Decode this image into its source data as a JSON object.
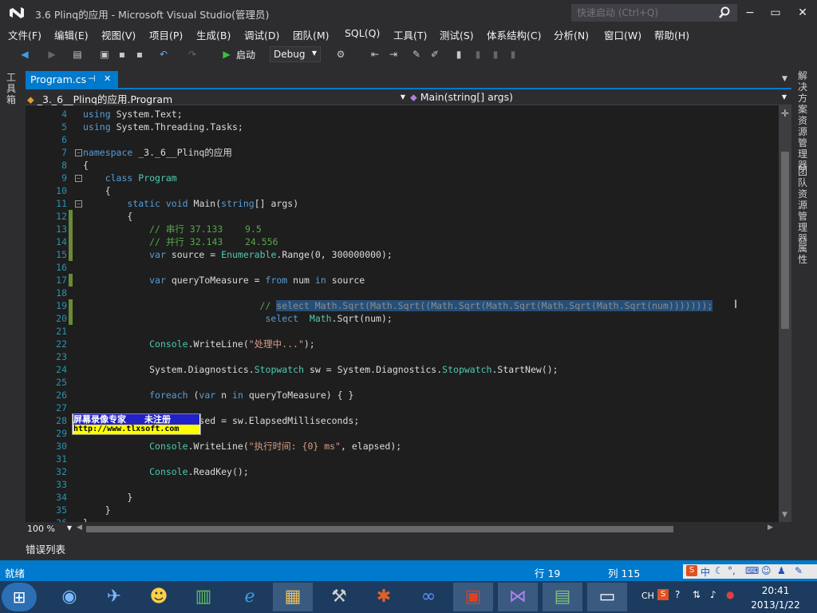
{
  "window": {
    "title": "3.6  Plinq的应用 - Microsoft Visual Studio(管理员)",
    "quick_launch_placeholder": "快速启动 (Ctrl+Q)",
    "minimize": "−",
    "restore": "▭",
    "close": "✕"
  },
  "menu": [
    "文件(F)",
    "编辑(E)",
    "视图(V)",
    "项目(P)",
    "生成(B)",
    "调试(D)",
    "团队(M)",
    "SQL(Q)",
    "工具(T)",
    "测试(S)",
    "体系结构(C)",
    "分析(N)",
    "窗口(W)",
    "帮助(H)"
  ],
  "toolbar": {
    "run_label": "启动",
    "config": "Debug"
  },
  "left_panel": {
    "toolbox": "工具箱"
  },
  "right_panel": {
    "solution_explorer": "解决方案资源管理器",
    "team_explorer": "团队资源管理器",
    "properties": "属性"
  },
  "tabs": {
    "active": "Program.cs",
    "pin": "⊣",
    "close": "✕"
  },
  "nav": {
    "type": "_3._6__Plinq的应用.Program",
    "member": "Main(string[] args)"
  },
  "code": [
    {
      "n": "4",
      "t": "using System.Text;"
    },
    {
      "n": "5",
      "t": "using System.Threading.Tasks;"
    },
    {
      "n": "6",
      "t": ""
    },
    {
      "n": "7",
      "t": "namespace _3._6__Plinq的应用"
    },
    {
      "n": "8",
      "t": "{"
    },
    {
      "n": "9",
      "t": "    class Program"
    },
    {
      "n": "10",
      "t": "    {"
    },
    {
      "n": "11",
      "t": "        static void Main(string[] args)"
    },
    {
      "n": "12",
      "t": "        {"
    },
    {
      "n": "13",
      "t": "            // 串行 37.133    9.5"
    },
    {
      "n": "14",
      "t": "            // 并行 32.143    24.556"
    },
    {
      "n": "15",
      "t": "            var source = Enumerable.Range(0, 300000000);"
    },
    {
      "n": "16",
      "t": ""
    },
    {
      "n": "17",
      "t": "            var queryToMeasure = from num in source"
    },
    {
      "n": "18",
      "t": ""
    },
    {
      "n": "19",
      "t": "                                // select Math.Sqrt(Math.Sqrt((Math.Sqrt(Math.Sqrt(Math.Sqrt(Math.Sqrt(num)))))));"
    },
    {
      "n": "20",
      "t": "                                 select  Math.Sqrt(num);"
    },
    {
      "n": "21",
      "t": ""
    },
    {
      "n": "22",
      "t": "            Console.WriteLine(\"处理中...\");"
    },
    {
      "n": "23",
      "t": ""
    },
    {
      "n": "24",
      "t": "            System.Diagnostics.Stopwatch sw = System.Diagnostics.Stopwatch.StartNew();"
    },
    {
      "n": "25",
      "t": ""
    },
    {
      "n": "26",
      "t": "            foreach (var n in queryToMeasure) { }"
    },
    {
      "n": "27",
      "t": ""
    },
    {
      "n": "28",
      "t": "            long elapsed = sw.ElapsedMilliseconds;"
    },
    {
      "n": "29",
      "t": ""
    },
    {
      "n": "30",
      "t": "            Console.WriteLine(\"执行时间: {0} ms\", elapsed);"
    },
    {
      "n": "31",
      "t": ""
    },
    {
      "n": "32",
      "t": "            Console.ReadKey();"
    },
    {
      "n": "33",
      "t": ""
    },
    {
      "n": "34",
      "t": "        }"
    },
    {
      "n": "35",
      "t": "    }"
    },
    {
      "n": "36",
      "t": "}"
    }
  ],
  "zoom": "100 %",
  "error_list": "错误列表",
  "status": {
    "ready": "就绪",
    "row": "行 19",
    "col": "列 115"
  },
  "watermark": {
    "title": "屏幕录像专家      未注册",
    "url": "http://www.tlxsoft.com"
  },
  "taskbar": {
    "lang": "CH",
    "time": "20:41",
    "date": "2013/1/22"
  },
  "colors": {
    "accent": "#007acc",
    "editor_bg": "#1e1e1e",
    "chrome_bg": "#2d2d30"
  }
}
